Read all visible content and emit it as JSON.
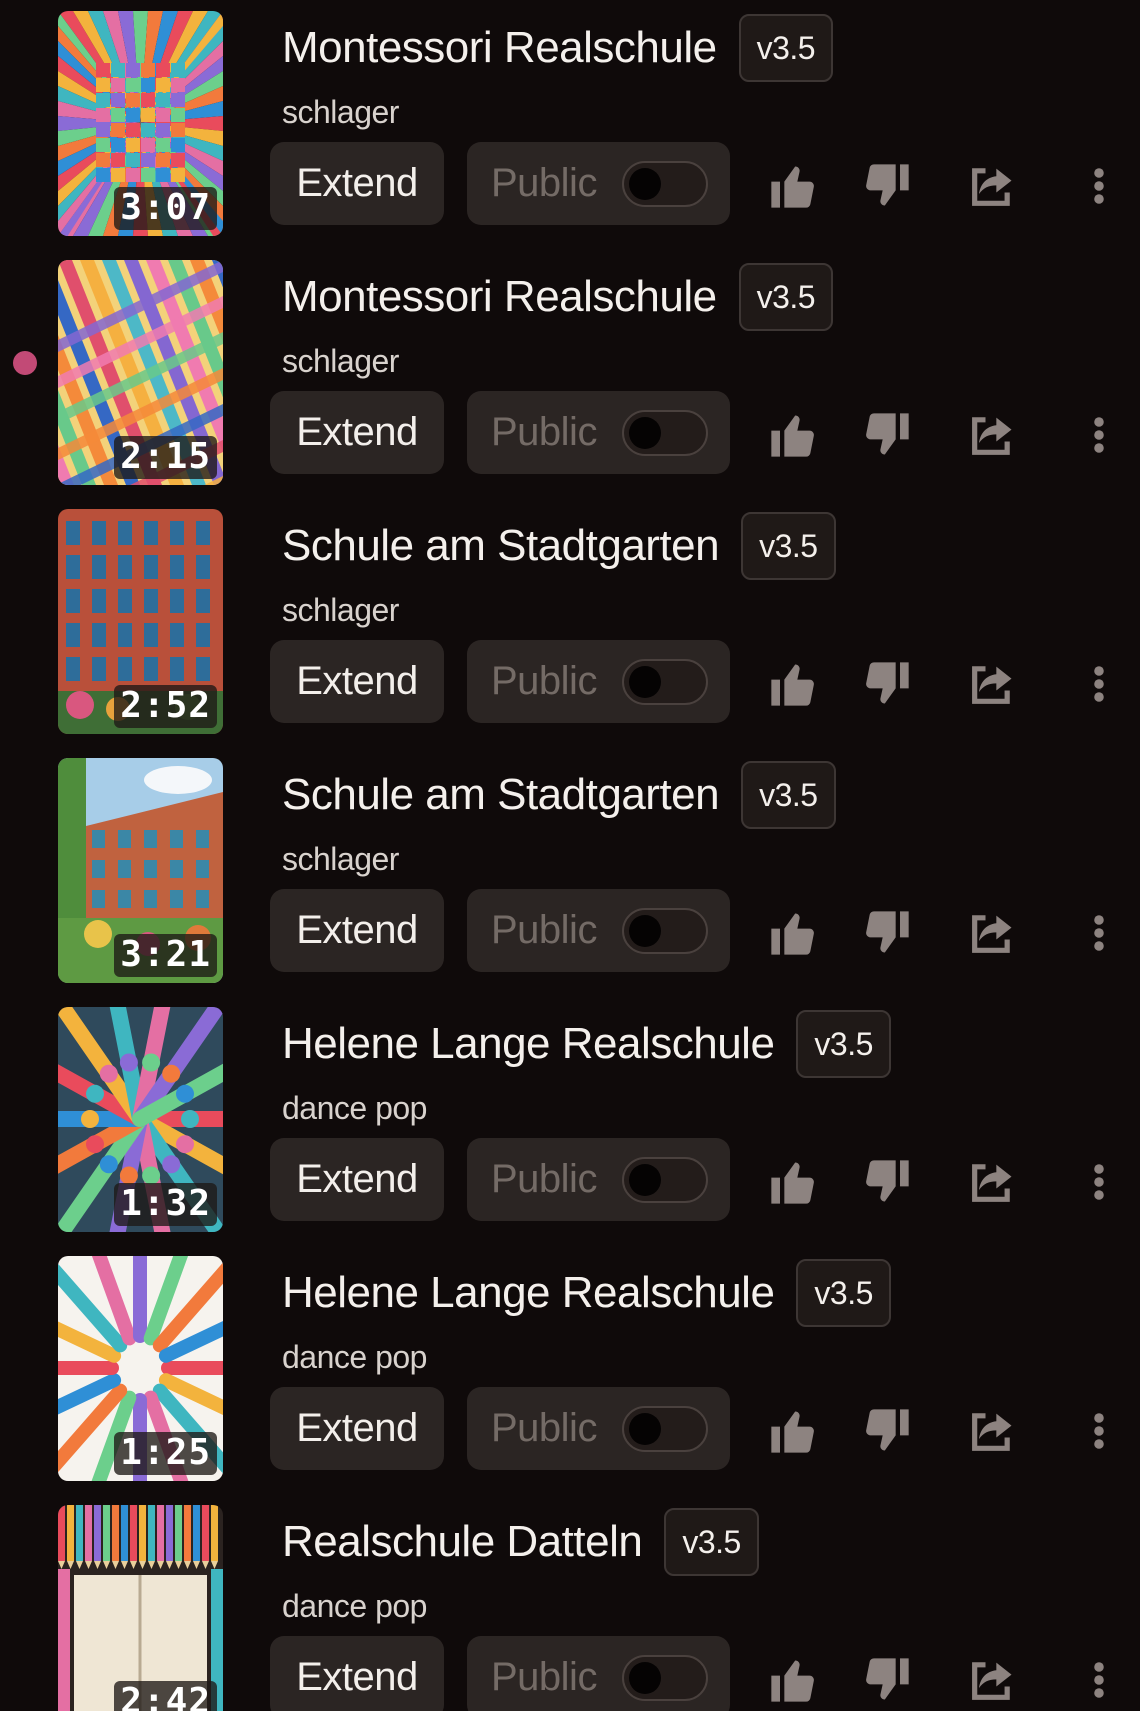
{
  "colors": {
    "background": "#0f0a0a",
    "button_bg": "#2b2523",
    "muted_text": "#746b66",
    "indicator_dot": "#c24a76"
  },
  "songs": [
    {
      "title": "Montessori Realschule",
      "version": "v3.5",
      "genre": "schlager",
      "duration": "3:07",
      "extend_label": "Extend",
      "public_label": "Public",
      "public_enabled": false,
      "playing": false,
      "thumbnail": "geometric-tunnel"
    },
    {
      "title": "Montessori Realschule",
      "version": "v3.5",
      "genre": "schlager",
      "duration": "2:15",
      "extend_label": "Extend",
      "public_label": "Public",
      "public_enabled": false,
      "playing": true,
      "thumbnail": "colorful-stripes"
    },
    {
      "title": "Schule am Stadtgarten",
      "version": "v3.5",
      "genre": "schlager",
      "duration": "2:52",
      "extend_label": "Extend",
      "public_label": "Public",
      "public_enabled": false,
      "playing": false,
      "thumbnail": "brick-school-building"
    },
    {
      "title": "Schule am Stadtgarten",
      "version": "v3.5",
      "genre": "schlager",
      "duration": "3:21",
      "extend_label": "Extend",
      "public_label": "Public",
      "public_enabled": false,
      "playing": false,
      "thumbnail": "school-building-garden"
    },
    {
      "title": "Helene Lange Realschule",
      "version": "v3.5",
      "genre": "dance pop",
      "duration": "1:32",
      "extend_label": "Extend",
      "public_label": "Public",
      "public_enabled": false,
      "playing": false,
      "thumbnail": "colorful-hands"
    },
    {
      "title": "Helene Lange Realschule",
      "version": "v3.5",
      "genre": "dance pop",
      "duration": "1:25",
      "extend_label": "Extend",
      "public_label": "Public",
      "public_enabled": false,
      "playing": false,
      "thumbnail": "colorful-hands-white"
    },
    {
      "title": "Realschule Datteln",
      "version": "v3.5",
      "genre": "dance pop",
      "duration": "2:42",
      "extend_label": "Extend",
      "public_label": "Public",
      "public_enabled": false,
      "playing": false,
      "thumbnail": "notebook-pencils"
    }
  ],
  "icons": {
    "like": "thumbs-up-icon",
    "dislike": "thumbs-down-icon",
    "share": "share-icon",
    "more": "more-options-icon"
  }
}
